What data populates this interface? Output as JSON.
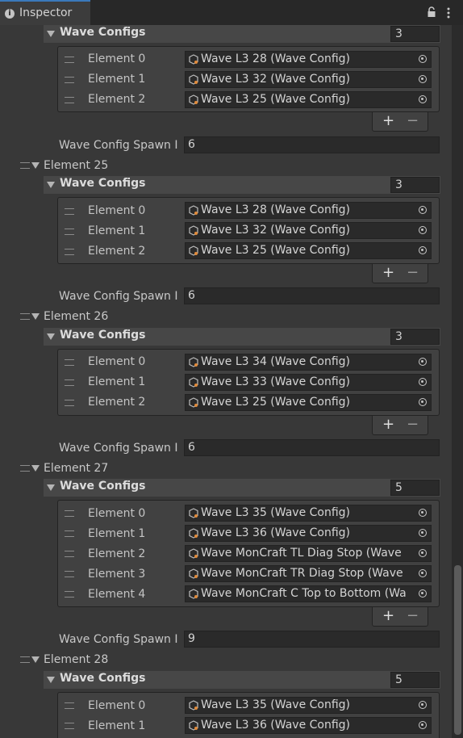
{
  "tab": {
    "title": "Inspector",
    "icon": "info-icon"
  },
  "header_icons": [
    "lock-icon",
    "kebab-menu-icon"
  ],
  "labels": {
    "wave_configs": "Wave Configs",
    "spawn": "Wave Config Spawn I",
    "plus": "+",
    "minus": "−"
  },
  "top_block": {
    "count": "3",
    "elements": [
      {
        "label": "Element 0",
        "value": "Wave L3 28 (Wave Config)"
      },
      {
        "label": "Element 1",
        "value": "Wave L3 32 (Wave Config)"
      },
      {
        "label": "Element 2",
        "value": "Wave L3 25 (Wave Config)"
      }
    ],
    "spawn_value": "6"
  },
  "element_25": {
    "title": "Element 25",
    "count": "3",
    "elements": [
      {
        "label": "Element 0",
        "value": "Wave L3 28 (Wave Config)"
      },
      {
        "label": "Element 1",
        "value": "Wave L3 32 (Wave Config)"
      },
      {
        "label": "Element 2",
        "value": "Wave L3 25 (Wave Config)"
      }
    ],
    "spawn_value": "6"
  },
  "element_26": {
    "title": "Element 26",
    "count": "3",
    "elements": [
      {
        "label": "Element 0",
        "value": "Wave L3 34 (Wave Config)"
      },
      {
        "label": "Element 1",
        "value": "Wave L3 33 (Wave Config)"
      },
      {
        "label": "Element 2",
        "value": "Wave L3 25 (Wave Config)"
      }
    ],
    "spawn_value": "6"
  },
  "element_27": {
    "title": "Element 27",
    "count": "5",
    "elements": [
      {
        "label": "Element 0",
        "value": "Wave L3 35 (Wave Config)"
      },
      {
        "label": "Element 1",
        "value": "Wave L3 36 (Wave Config)"
      },
      {
        "label": "Element 2",
        "value": "Wave MonCraft TL Diag Stop (Wave"
      },
      {
        "label": "Element 3",
        "value": "Wave MonCraft TR Diag Stop (Wave"
      },
      {
        "label": "Element 4",
        "value": "Wave MonCraft C Top to Bottom (Wa"
      }
    ],
    "spawn_value": "9"
  },
  "element_28": {
    "title": "Element 28",
    "count": "5",
    "elements": [
      {
        "label": "Element 0",
        "value": "Wave L3 35 (Wave Config)"
      },
      {
        "label": "Element 1",
        "value": "Wave L3 36 (Wave Config)"
      }
    ]
  }
}
